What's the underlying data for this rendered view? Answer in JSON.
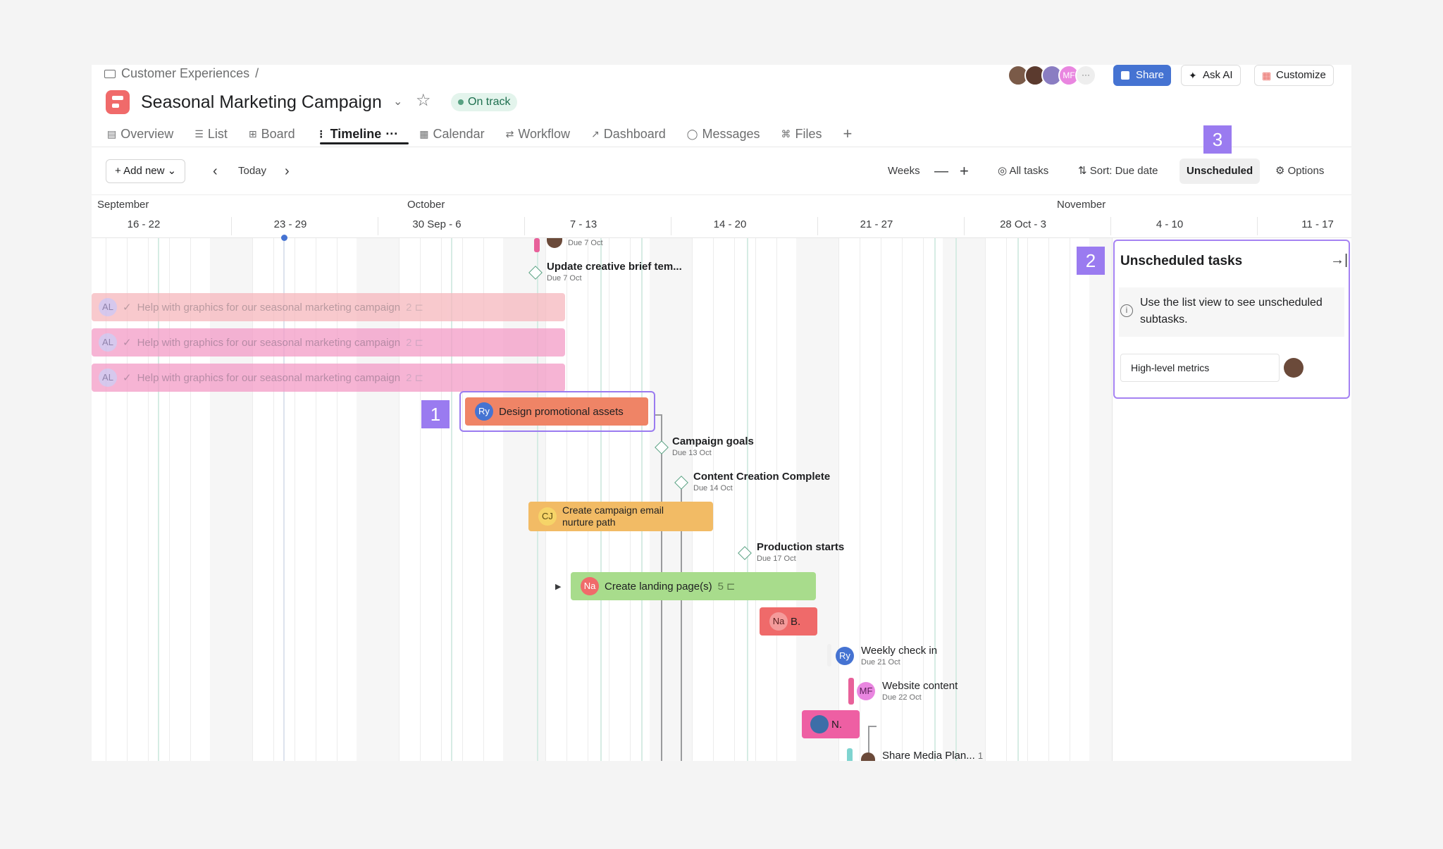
{
  "header": {
    "breadcrumb": "Customer Experiences",
    "breadcrumb_sep": "/",
    "project_title": "Seasonal Marketing Campaign",
    "status": "On track",
    "avatars": [
      {
        "initials": "",
        "color": "#7a5a48"
      },
      {
        "initials": "",
        "color": "#5b3a2e"
      },
      {
        "initials": "",
        "color": "#8a7dc2"
      },
      {
        "initials": "MF",
        "color": "#e986e0"
      }
    ],
    "more_label": "···",
    "share_label": "Share",
    "ask_ai_label": "Ask AI",
    "customize_label": "Customize"
  },
  "tabs": [
    {
      "label": "Overview",
      "icon": "▤"
    },
    {
      "label": "List",
      "icon": "☰"
    },
    {
      "label": "Board",
      "icon": "⊞"
    },
    {
      "label": "Timeline",
      "icon": "⋮",
      "active": true
    },
    {
      "label": "Calendar",
      "icon": "▦"
    },
    {
      "label": "Workflow",
      "icon": "⇄"
    },
    {
      "label": "Dashboard",
      "icon": "↗"
    },
    {
      "label": "Messages",
      "icon": "◯"
    },
    {
      "label": "Files",
      "icon": "⌘"
    }
  ],
  "tab_more": "···",
  "tab_add": "+",
  "toolbar": {
    "add_new": "Add new",
    "today": "Today",
    "zoom": "Weeks",
    "all_tasks": "All tasks",
    "sort": "Sort: Due date",
    "unscheduled": "Unscheduled",
    "options": "Options"
  },
  "calendar": {
    "months": [
      "September",
      "October",
      "November"
    ],
    "weeks": [
      "16 - 22",
      "23 - 29",
      "30 Sep - 6",
      "7 - 13",
      "14 - 20",
      "21 - 27",
      "28 Oct - 3",
      "4 - 10",
      "11 - 17"
    ]
  },
  "tasks": {
    "top_task_due": "Due 7 Oct",
    "creative_brief": {
      "title": "Update creative brief tem...",
      "due": "Due 7 Oct"
    },
    "graphics_rows": [
      {
        "initials": "AL",
        "title": "Help with graphics for our seasonal marketing campaign",
        "count": "2"
      },
      {
        "initials": "AL",
        "title": "Help with graphics for our seasonal marketing campaign",
        "count": "2"
      },
      {
        "initials": "AL",
        "title": "Help with graphics for our seasonal marketing campaign",
        "count": "2"
      }
    ],
    "design": {
      "initials": "Ry",
      "title": "Design promotional assets"
    },
    "campaign_goals": {
      "title": "Campaign goals",
      "due": "Due 13 Oct"
    },
    "content_complete": {
      "title": "Content Creation Complete",
      "due": "Due 14 Oct"
    },
    "email": {
      "initials": "CJ",
      "title_line1": "Create campaign email",
      "title_line2": "nurture path"
    },
    "production": {
      "title": "Production starts",
      "due": "Due 17 Oct"
    },
    "landing": {
      "initials": "Na",
      "title": "Create landing page(s)",
      "count": "5"
    },
    "nab": {
      "initials": "Na",
      "title": "B."
    },
    "weekly": {
      "initials": "Ry",
      "title": "Weekly check in",
      "due": "Due 21 Oct"
    },
    "website": {
      "initials": "MF",
      "title": "Website content",
      "due": "Due 22 Oct"
    },
    "n_task": {
      "title": "N."
    },
    "share_media": {
      "title": "Share Media Plan...",
      "count": "1"
    }
  },
  "markers": [
    "1",
    "2",
    "3"
  ],
  "panel": {
    "title": "Unscheduled tasks",
    "note": "Use the list view to see unscheduled subtasks.",
    "info_icon": "i",
    "item": "High-level metrics"
  }
}
